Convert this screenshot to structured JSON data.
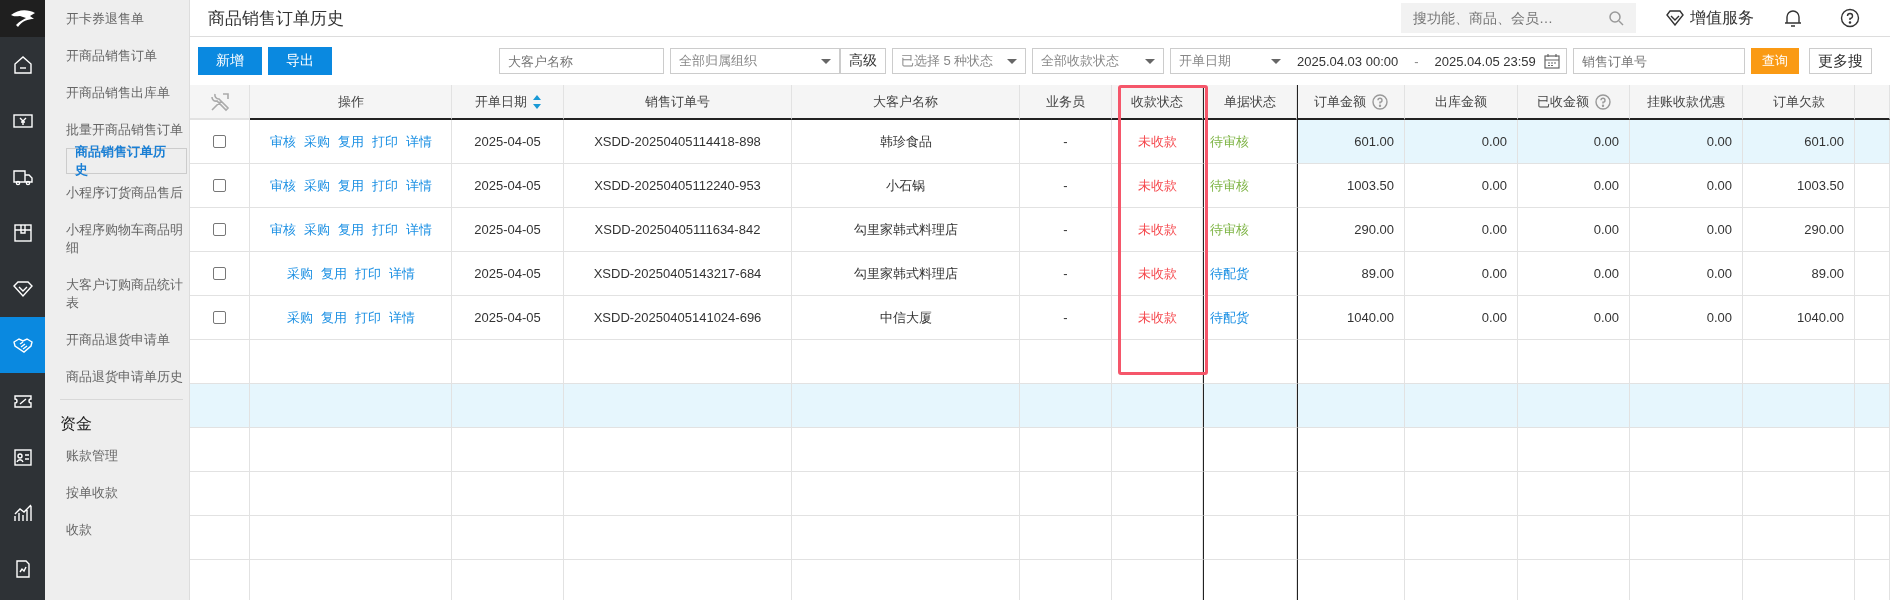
{
  "sidebar": {
    "items": [
      {
        "label": "开卡券退售单",
        "selected": false
      },
      {
        "label": "开商品销售订单",
        "selected": false
      },
      {
        "label": "开商品销售出库单",
        "selected": false
      },
      {
        "label": "批量开商品销售订单",
        "selected": false
      },
      {
        "label": "商品销售订单历史",
        "selected": true
      },
      {
        "label": "小程序订货商品售后",
        "selected": false
      },
      {
        "label": "小程序购物车商品明细",
        "selected": false
      },
      {
        "label": "大客户订购商品统计表",
        "selected": false
      },
      {
        "label": "开商品退货申请单",
        "selected": false
      },
      {
        "label": "商品退货申请单历史",
        "selected": false
      }
    ],
    "section": {
      "title": "资金",
      "items": [
        {
          "label": "账款管理",
          "selected": false
        },
        {
          "label": "按单收款",
          "selected": false
        },
        {
          "label": "收款",
          "selected": false
        }
      ]
    }
  },
  "rail": {
    "items": [
      {
        "selected": false
      },
      {
        "selected": false
      },
      {
        "selected": false
      },
      {
        "selected": false
      },
      {
        "selected": false
      },
      {
        "selected": true
      },
      {
        "selected": false
      },
      {
        "selected": false
      },
      {
        "selected": false
      },
      {
        "selected": false
      }
    ]
  },
  "page_title": "商品销售订单历史",
  "header": {
    "search_placeholder": "搜功能、商品、会员…",
    "value_service": "增值服务"
  },
  "toolbar": {
    "buttons": [
      "新增",
      "导出"
    ],
    "customer_placeholder": "大客户名称",
    "org_select": "全部归属组织",
    "advanced": "高级",
    "status_select": "已选择 5 种状态",
    "payment_select": "全部收款状态",
    "date_select": "开单日期",
    "date_from": "2025.04.03 00:00",
    "date_sep": "-",
    "date_to": "2025.04.05 23:59",
    "order_placeholder": "销售订单号",
    "query": "查询",
    "more": "更多搜"
  },
  "table": {
    "columns": [
      "操作",
      "开单日期",
      "销售订单号",
      "大客户名称",
      "业务员",
      "收款状态",
      "单据状态",
      "订单金额",
      "出库金额",
      "已收金额",
      "挂账收款优惠",
      "订单欠款"
    ],
    "rows": [
      {
        "checked": false,
        "selected": true,
        "actions": [
          "审核",
          "采购",
          "复用",
          "打印",
          "详情"
        ],
        "date": "2025-04-05",
        "order_no": "XSDD-20250405114418-898",
        "customer": "韩珍食品",
        "salesperson": "-",
        "payment_status": {
          "text": "未收款",
          "color": "#f5484d"
        },
        "doc_status": {
          "text": "待审核",
          "color": "#7cb342"
        },
        "amounts": [
          "601.00",
          "0.00",
          "0.00",
          "0.00",
          "601.00"
        ]
      },
      {
        "checked": false,
        "selected": false,
        "actions": [
          "审核",
          "采购",
          "复用",
          "打印",
          "详情"
        ],
        "date": "2025-04-05",
        "order_no": "XSDD-20250405112240-953",
        "customer": "小石锅",
        "salesperson": "-",
        "payment_status": {
          "text": "未收款",
          "color": "#f5484d"
        },
        "doc_status": {
          "text": "待审核",
          "color": "#7cb342"
        },
        "amounts": [
          "1003.50",
          "0.00",
          "0.00",
          "0.00",
          "1003.50"
        ]
      },
      {
        "checked": false,
        "selected": false,
        "actions": [
          "审核",
          "采购",
          "复用",
          "打印",
          "详情"
        ],
        "date": "2025-04-05",
        "order_no": "XSDD-20250405111634-842",
        "customer": "勾里家韩式料理店",
        "salesperson": "-",
        "payment_status": {
          "text": "未收款",
          "color": "#f5484d"
        },
        "doc_status": {
          "text": "待审核",
          "color": "#7cb342"
        },
        "amounts": [
          "290.00",
          "0.00",
          "0.00",
          "0.00",
          "290.00"
        ]
      },
      {
        "checked": false,
        "selected": false,
        "actions": [
          "采购",
          "复用",
          "打印",
          "详情"
        ],
        "date": "2025-04-05",
        "order_no": "XSDD-20250405143217-684",
        "customer": "勾里家韩式料理店",
        "salesperson": "-",
        "payment_status": {
          "text": "未收款",
          "color": "#f5484d"
        },
        "doc_status": {
          "text": "待配货",
          "color": "#1a8fe3"
        },
        "amounts": [
          "89.00",
          "0.00",
          "0.00",
          "0.00",
          "89.00"
        ]
      },
      {
        "checked": false,
        "selected": false,
        "actions": [
          "采购",
          "复用",
          "打印",
          "详情"
        ],
        "date": "2025-04-05",
        "order_no": "XSDD-20250405141024-696",
        "customer": "中信大厦",
        "salesperson": "-",
        "payment_status": {
          "text": "未收款",
          "color": "#f5484d"
        },
        "doc_status": {
          "text": "待配货",
          "color": "#1a8fe3"
        },
        "amounts": [
          "1040.00",
          "0.00",
          "0.00",
          "0.00",
          "1040.00"
        ]
      }
    ]
  }
}
